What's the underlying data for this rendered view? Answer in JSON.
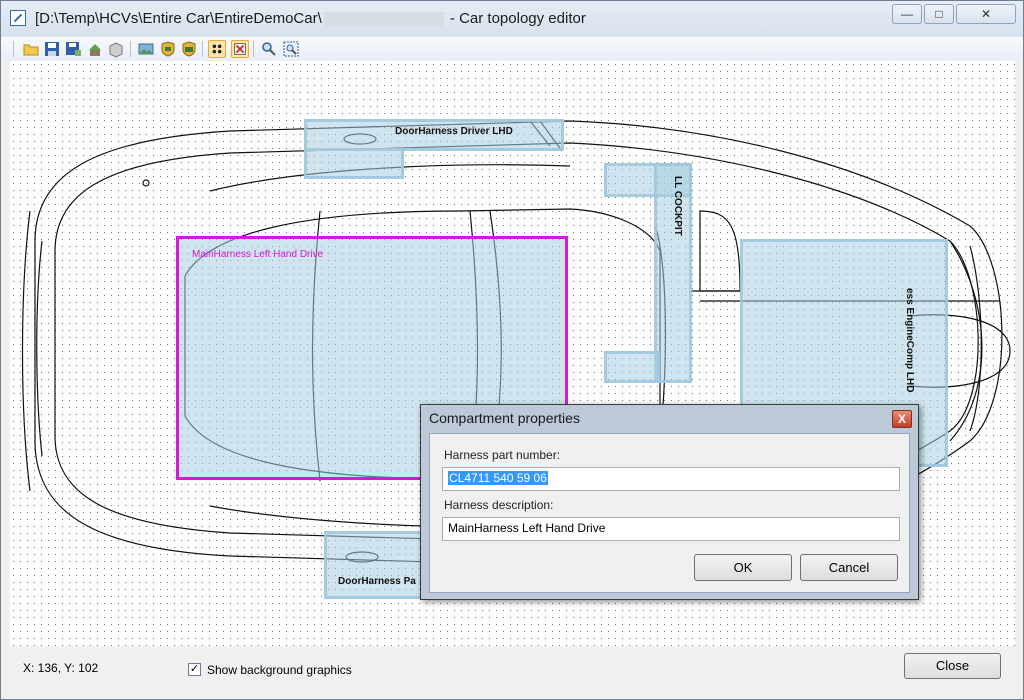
{
  "window": {
    "title_prefix": "[D:\\Temp\\HCVs\\Entire Car\\EntireDemoCar\\",
    "title_suffix": "- Car topology editor",
    "controls": {
      "minimize": "—",
      "maximize": "□",
      "close": "✕"
    }
  },
  "toolbar": {
    "buttons": [
      "open-icon",
      "save-icon",
      "save-as-icon",
      "export-icon",
      "package-icon",
      "image-icon",
      "shield-icon",
      "shield-add-icon",
      "grid-icon",
      "delete-icon",
      "zoom-icon",
      "fit-icon"
    ],
    "selected": [
      "grid-icon",
      "delete-icon"
    ]
  },
  "compartments": {
    "door_driver": "DoorHarness Driver LHD",
    "ll_cockpit": "LL COCKPIT",
    "main_left": "MainHarness Left Hand Drive",
    "engine_comp": "ess EngineComp LHD",
    "door_passenger": "DoorHarness Pa"
  },
  "status": {
    "coords": "X: 136, Y: 102",
    "show_bg_label": "Show background graphics",
    "show_bg_checked": "✓"
  },
  "close_button": "Close",
  "dialog": {
    "title": "Compartment properties",
    "close_glyph": "X",
    "part_number_label": "Harness part number:",
    "part_number_value": "CL4711 540 59 06",
    "description_label": "Harness description:",
    "description_value": "MainHarness Left Hand Drive",
    "ok": "OK",
    "cancel": "Cancel"
  },
  "colors": {
    "selection": "#d11bd5",
    "compartment_fill": "#a8cde0",
    "dialog_frame": "#bcc9d9"
  }
}
